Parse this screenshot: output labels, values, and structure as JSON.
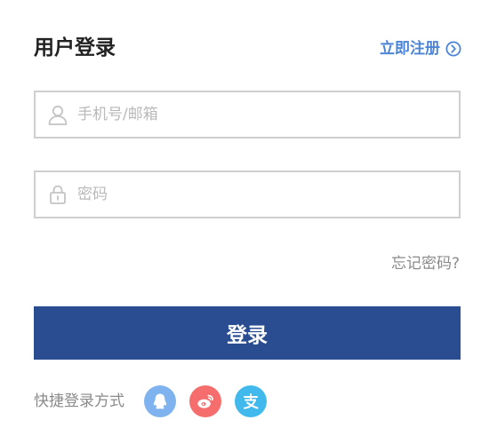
{
  "header": {
    "title": "用户登录",
    "register_label": "立即注册"
  },
  "form": {
    "username_placeholder": "手机号/邮箱",
    "username_value": "",
    "password_placeholder": "密码",
    "password_value": "",
    "forgot_label": "忘记密码?",
    "login_label": "登录"
  },
  "quick_login": {
    "label": "快捷登录方式",
    "providers": [
      {
        "icon": "qq-icon",
        "color": "#7eb3ef"
      },
      {
        "icon": "weibo-icon",
        "color": "#f56d6d"
      },
      {
        "icon": "alipay-icon",
        "color": "#42b9ec"
      }
    ]
  },
  "colors": {
    "accent": "#4d85d6",
    "primary_button": "#2a4d91",
    "border": "#cfcfcf",
    "muted_text": "#8a8a8a"
  }
}
